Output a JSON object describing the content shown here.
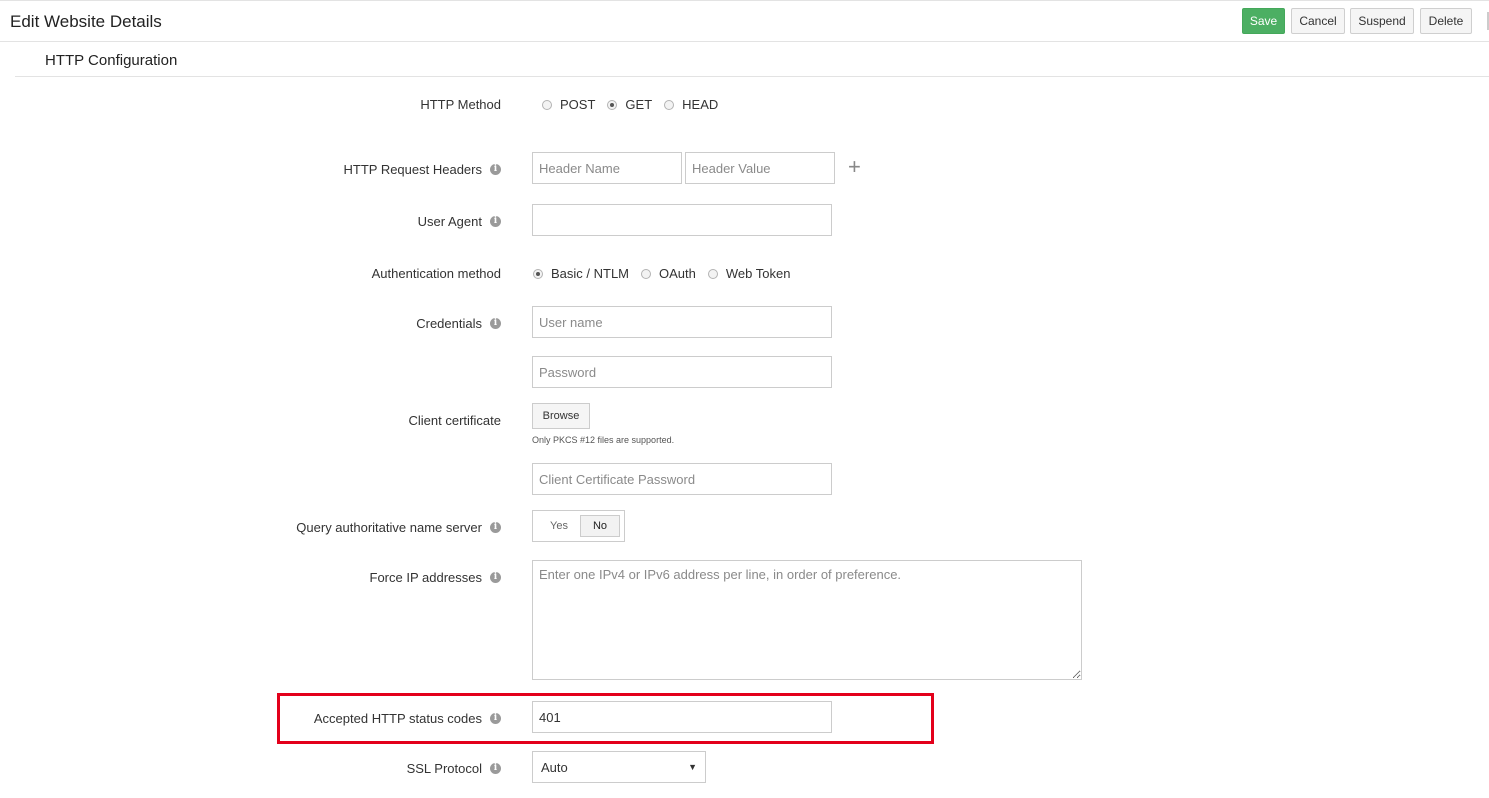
{
  "header": {
    "title": "Edit Website Details"
  },
  "toolbar": {
    "save_label": "Save",
    "cancel_label": "Cancel",
    "suspend_label": "Suspend",
    "delete_label": "Delete"
  },
  "section": {
    "title": "HTTP Configuration"
  },
  "http_method": {
    "label": "HTTP Method",
    "options": [
      "POST",
      "GET",
      "HEAD"
    ],
    "selected": "GET"
  },
  "request_headers": {
    "label": "HTTP Request Headers",
    "name_placeholder": "Header Name",
    "value_placeholder": "Header Value",
    "add_icon": "plus-icon"
  },
  "user_agent": {
    "label": "User Agent",
    "value": ""
  },
  "auth_method": {
    "label": "Authentication method",
    "options": [
      "Basic / NTLM",
      "OAuth",
      "Web Token"
    ],
    "selected": "Basic / NTLM"
  },
  "credentials": {
    "label": "Credentials",
    "username_placeholder": "User name",
    "password_placeholder": "Password"
  },
  "client_certificate": {
    "label": "Client certificate",
    "browse_label": "Browse",
    "hint": "Only PKCS #12 files are supported.",
    "password_placeholder": "Client Certificate Password"
  },
  "query_ns": {
    "label": "Query authoritative name server",
    "yes_label": "Yes",
    "no_label": "No",
    "selected": "No"
  },
  "force_ip": {
    "label": "Force IP addresses",
    "placeholder": "Enter one IPv4 or IPv6 address per line, in order of preference."
  },
  "accepted_codes": {
    "label": "Accepted HTTP status codes",
    "value": "401"
  },
  "ssl_protocol": {
    "label": "SSL Protocol",
    "selected": "Auto"
  },
  "colors": {
    "save_button": "#4caf63",
    "highlight_border": "#e3001b"
  }
}
